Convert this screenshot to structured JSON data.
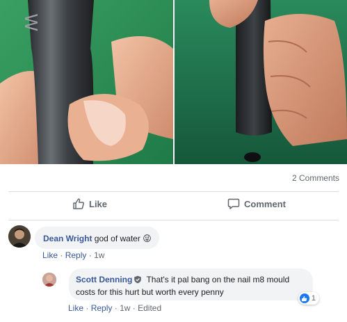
{
  "post": {
    "comments_count": "2 Comments",
    "actions": {
      "like_label": "Like",
      "comment_label": "Comment"
    }
  },
  "comments": [
    {
      "author": "Dean Wright",
      "text": "god of water",
      "emoji": "😜",
      "meta": {
        "like": "Like",
        "reply": "Reply",
        "sep": "·",
        "time": "1w"
      }
    },
    {
      "author": "Scott Denning",
      "text": "That's it pal bang on the nail m8 mould costs for this hurt but worth every penny",
      "reaction_count": "1",
      "meta": {
        "like": "Like",
        "reply": "Reply",
        "sep": "·",
        "time": "1w",
        "edited": "Edited"
      }
    }
  ],
  "colors": {
    "link": "#385898",
    "muted": "#606770",
    "bubble": "#f2f3f5",
    "accent": "#1877f2"
  }
}
